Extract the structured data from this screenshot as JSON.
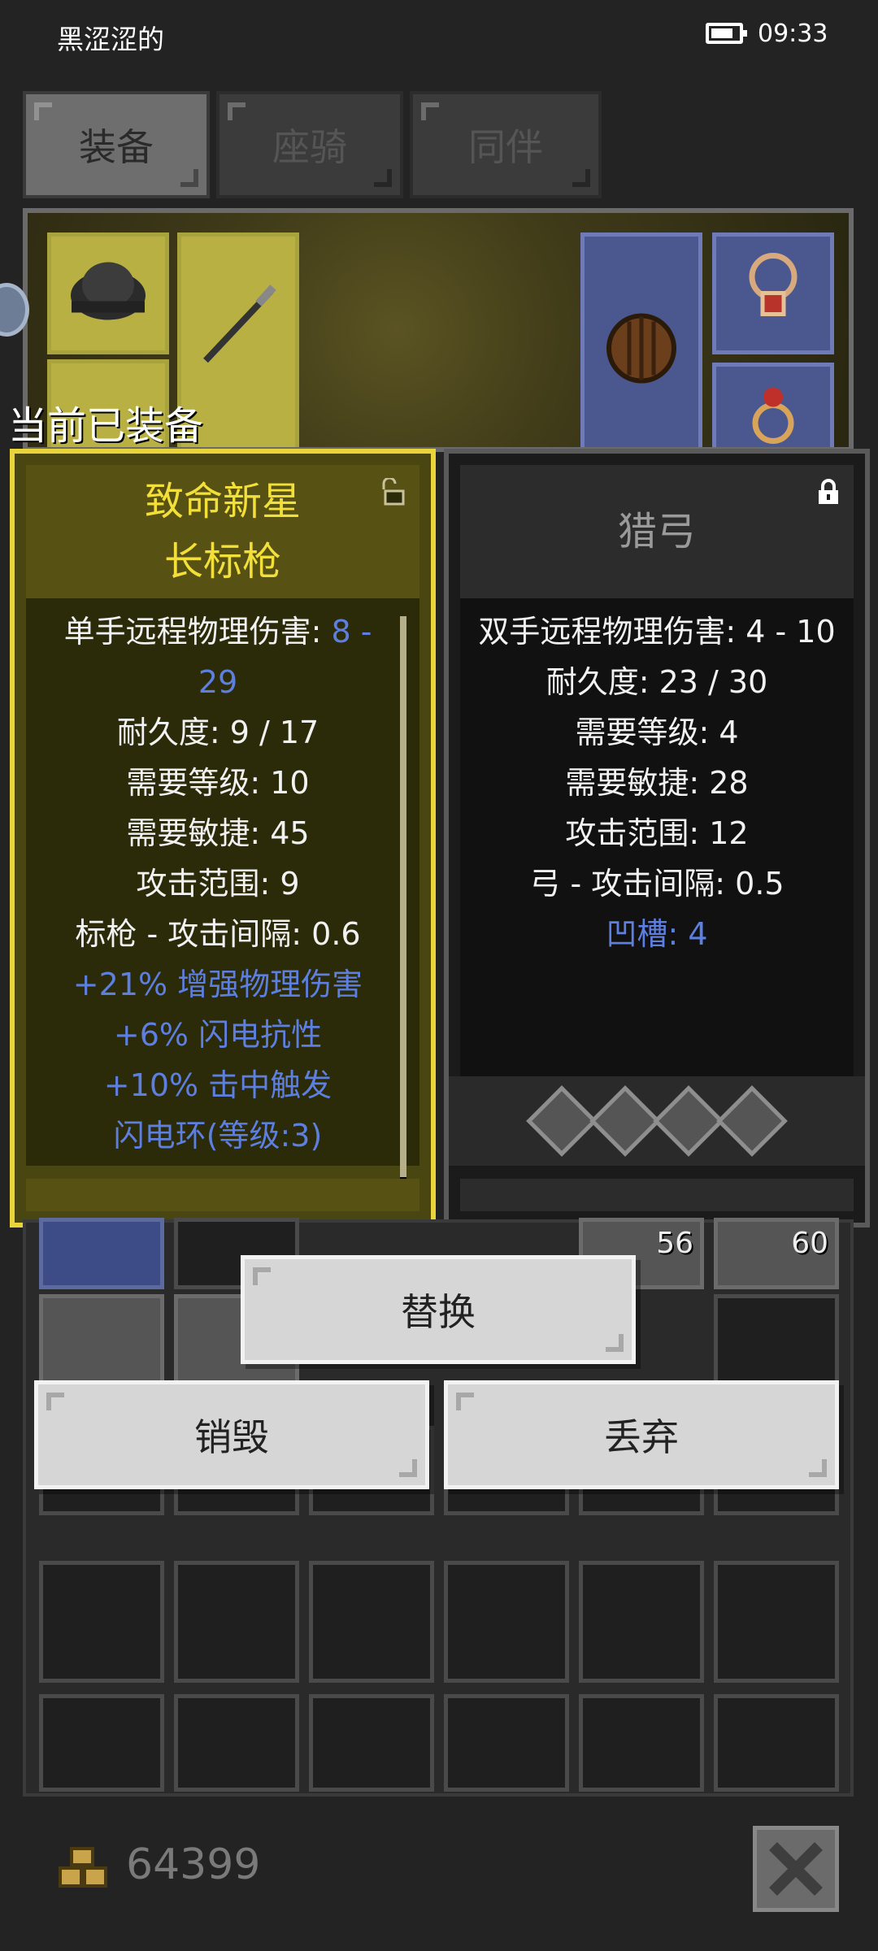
{
  "status_bar": {
    "carrier": "黑涩涩的",
    "time": "09:33",
    "battery_icon": "battery-icon"
  },
  "tabs": [
    {
      "label": "装备",
      "active": true
    },
    {
      "label": "座骑",
      "active": false
    },
    {
      "label": "同伴",
      "active": false
    }
  ],
  "equipped_title": "当前已装备",
  "current_item": {
    "name_line1": "致命新星",
    "name_line2": "长标枪",
    "lock_icon": "unlocked-padlock-icon",
    "stats": {
      "damage_label": "单手远程物理伤害:",
      "damage_value": "8 - 29",
      "durability": "耐久度: 9 / 17",
      "req_level": "需要等级: 10",
      "req_agility": "需要敏捷: 45",
      "range": "攻击范围: 9",
      "interval": "标枪 - 攻击间隔: 0.6",
      "affix1": "+21% 增强物理伤害",
      "affix2": "+6% 闪电抗性",
      "affix3": "+10% 击中触发",
      "affix4": "闪电环(等级:3)"
    }
  },
  "compare_item": {
    "name": "猎弓",
    "lock_icon": "locked-padlock-icon",
    "stats": {
      "damage": "双手远程物理伤害: 4 - 10",
      "durability": "耐久度: 23 / 30",
      "req_level": "需要等级: 4",
      "req_agility": "需要敏捷: 28",
      "range": "攻击范围: 12",
      "interval": "弓 - 攻击间隔: 0.5",
      "sockets": "凹槽: 4"
    },
    "socket_count": 4
  },
  "inventory": {
    "counts": [
      "56",
      "60"
    ]
  },
  "actions": {
    "replace": "替换",
    "destroy": "销毁",
    "discard": "丢弃"
  },
  "footer": {
    "gold_amount": "64399",
    "gold_icon": "gold-coins-icon",
    "close_icon": "close-x-icon"
  },
  "colors": {
    "background": "#232323",
    "current_card_border": "#e9d43c",
    "item_name_yellow": "#f3df3a",
    "affix_blue": "#5d7fe0"
  }
}
